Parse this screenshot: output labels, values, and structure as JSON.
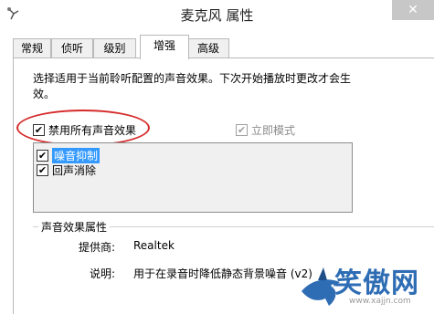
{
  "window": {
    "title": "麦克风 属性",
    "close_glyph": "✕"
  },
  "tabs": [
    {
      "label": "常规"
    },
    {
      "label": "侦听"
    },
    {
      "label": "级别"
    },
    {
      "label": "增强"
    },
    {
      "label": "高级"
    }
  ],
  "active_tab": "增强",
  "description": "选择适用于当前聆听配置的声音效果。下次开始播放时更改才会生效。",
  "disable_all": {
    "label": "禁用所有声音效果",
    "checked": true
  },
  "immediate_mode": {
    "label": "立即模式",
    "checked": true,
    "disabled": true
  },
  "effects": [
    {
      "label": "噪音抑制",
      "checked": true,
      "selected": true
    },
    {
      "label": "回声消除",
      "checked": true,
      "selected": false
    }
  ],
  "properties": {
    "group_title": "声音效果属性",
    "provider_label": "提供商:",
    "provider_value": "Realtek",
    "desc_label": "说明:",
    "desc_value": "用于在录音时降低静态背景噪音 (v2)"
  },
  "watermark": {
    "text": "笑傲网",
    "url": "www.xajjn.com"
  },
  "colors": {
    "annotation": "#d62b2b",
    "selection": "#3399ff",
    "watermark": "#2e6db4"
  }
}
